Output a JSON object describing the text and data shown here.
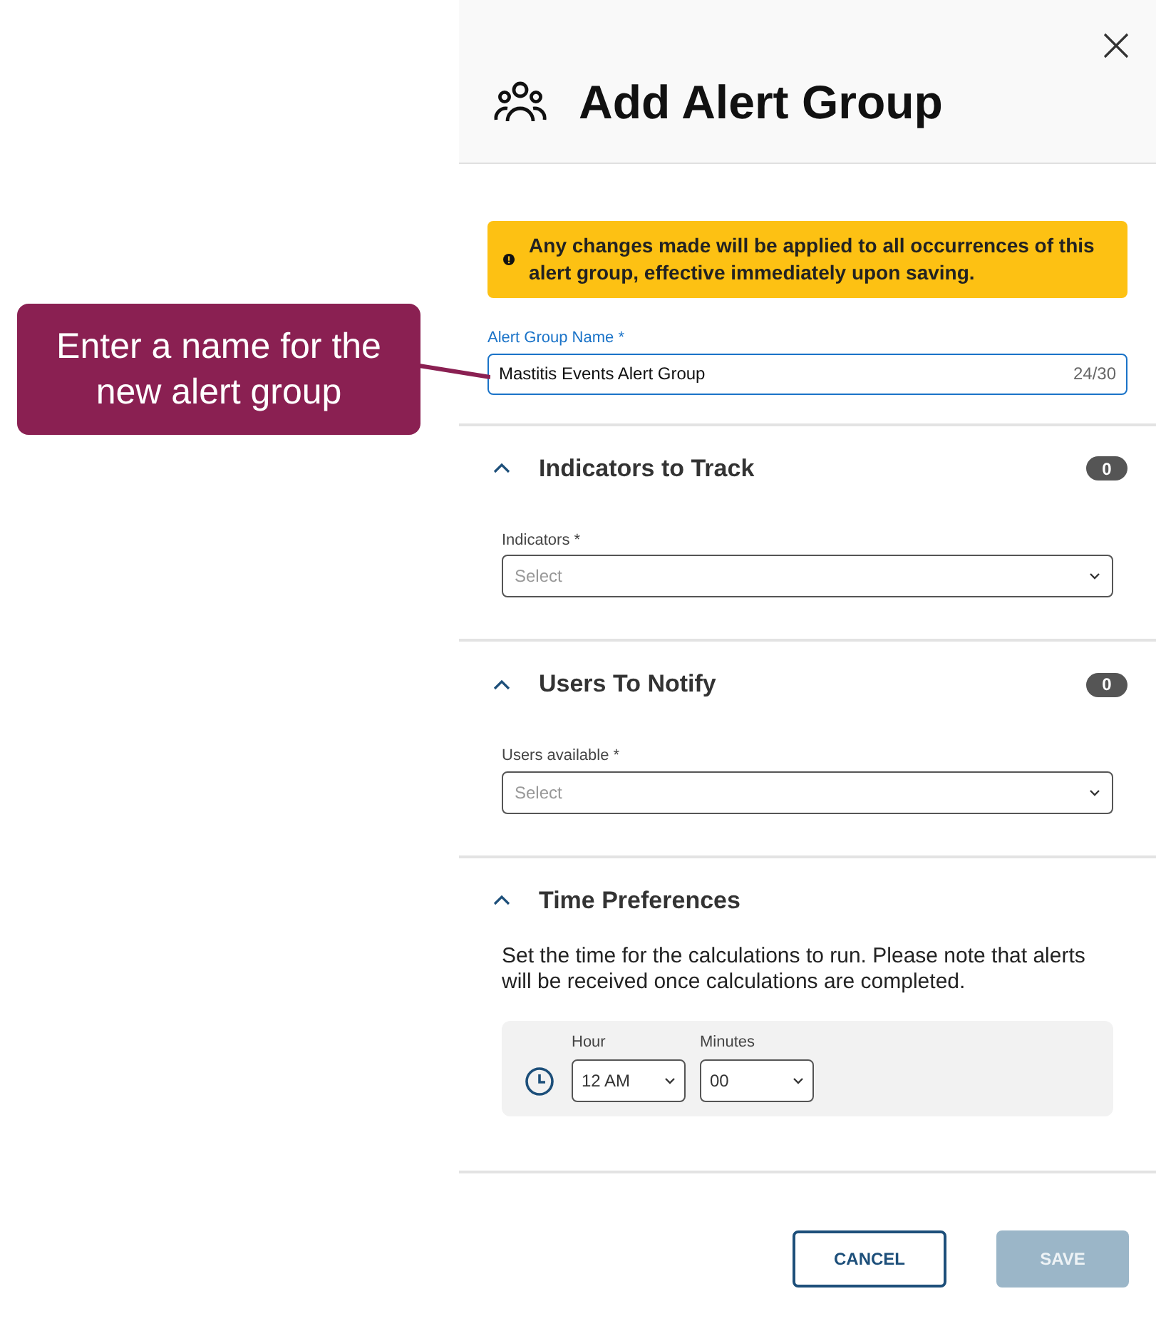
{
  "callout": {
    "text": "Enter a name for the new alert group"
  },
  "dialog": {
    "title": "Add Alert Group",
    "warning": "Any changes made will be applied to all occurrences of this alert group, effective immediately upon saving.",
    "name_field": {
      "label": "Alert Group Name *",
      "value": "Mastitis Events Alert Group",
      "counter": "24/30"
    },
    "sections": [
      {
        "kind": "select",
        "title": "Indicators to Track",
        "expanded": true,
        "count": "0",
        "field": {
          "label": "Indicators *",
          "placeholder": "Select"
        }
      },
      {
        "kind": "select",
        "title": "Users To Notify",
        "expanded": true,
        "count": "0",
        "field": {
          "label": "Users available *",
          "placeholder": "Select"
        }
      },
      {
        "kind": "time",
        "title": "Time Preferences",
        "expanded": true,
        "description": "Set the time for the calculations to run. Please note that alerts will be received once calculations are completed.",
        "hour": {
          "label": "Hour",
          "value": "12 AM"
        },
        "minutes": {
          "label": "Minutes",
          "value": "00"
        }
      }
    ],
    "buttons": [
      {
        "label": "CANCEL",
        "kind": "outline"
      },
      {
        "label": "SAVE",
        "kind": "primary",
        "disabled": true
      }
    ]
  }
}
